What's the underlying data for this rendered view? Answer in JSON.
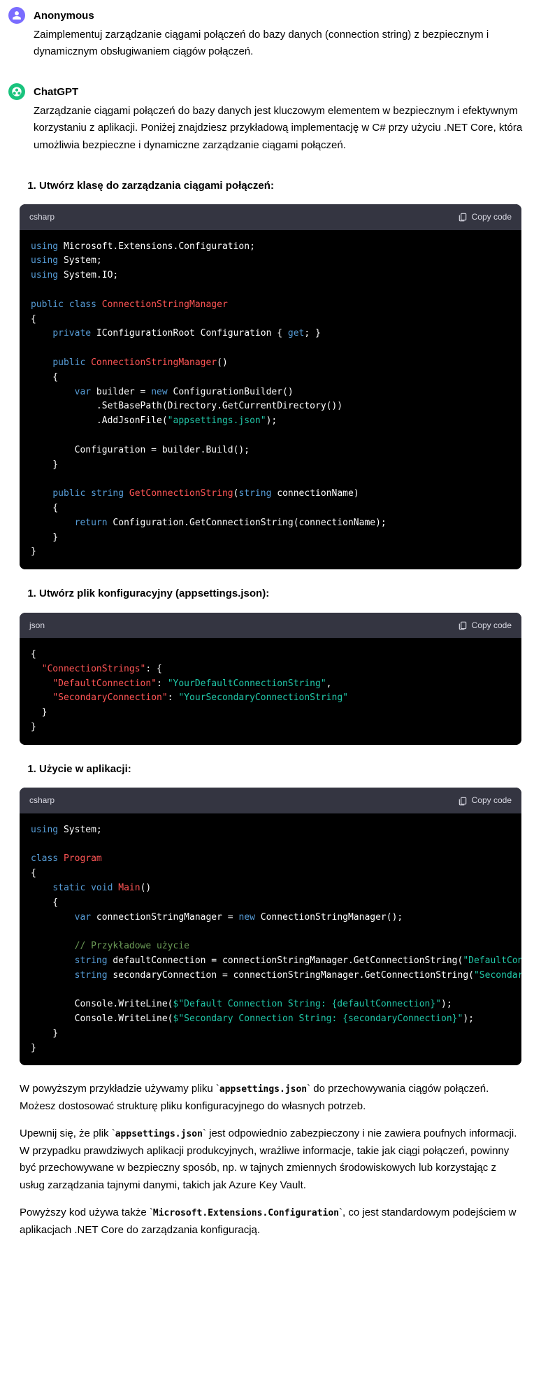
{
  "user": {
    "name": "Anonymous",
    "message": "Zaimplementuj zarządzanie ciągami połączeń do bazy danych (connection string) z bezpiecznym i dynamicznym obsługiwaniem ciągów połączeń."
  },
  "bot": {
    "name": "ChatGPT",
    "intro": "Zarządzanie ciągami połączeń do bazy danych jest kluczowym elementem w bezpiecznym i efektywnym korzystaniu z aplikacji. Poniżej znajdziesz przykładową implementację w C# przy użyciu .NET Core, która umożliwia bezpieczne i dynamiczne zarządzanie ciągami połączeń."
  },
  "steps": {
    "s1": "Utwórz klasę do zarządzania ciągami połączeń:",
    "s2": "Utwórz plik konfiguracyjny (appsettings.json):",
    "s3": "Użycie w aplikacji:"
  },
  "code": {
    "copy": "Copy code",
    "lang_csharp": "csharp",
    "lang_json": "json"
  },
  "outro": {
    "p1a": "W powyższym przykładzie używamy pliku ",
    "p1code": "appsettings.json",
    "p1b": " do przechowywania ciągów połączeń. Możesz dostosować strukturę pliku konfiguracyjnego do własnych potrzeb.",
    "p2a": "Upewnij się, że plik ",
    "p2code": "appsettings.json",
    "p2b": " jest odpowiednio zabezpieczony i nie zawiera poufnych informacji. W przypadku prawdziwych aplikacji produkcyjnych, wrażliwe informacje, takie jak ciągi połączeń, powinny być przechowywane w bezpieczny sposób, np. w tajnych zmiennych środowiskowych lub korzystając z usług zarządzania tajnymi danymi, takich jak Azure Key Vault.",
    "p3a": "Powyższy kod używa także ",
    "p3code": "Microsoft.Extensions.Configuration",
    "p3b": ", co jest standardowym podejściem w aplikacjach .NET Core do zarządzania konfiguracją."
  }
}
